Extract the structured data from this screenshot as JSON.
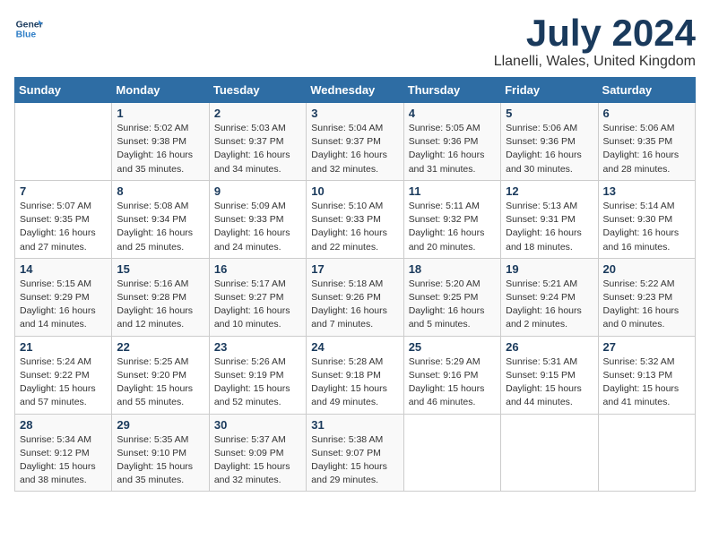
{
  "header": {
    "logo_line1": "General",
    "logo_line2": "Blue",
    "month": "July 2024",
    "location": "Llanelli, Wales, United Kingdom"
  },
  "days_of_week": [
    "Sunday",
    "Monday",
    "Tuesday",
    "Wednesday",
    "Thursday",
    "Friday",
    "Saturday"
  ],
  "weeks": [
    [
      {
        "day": "",
        "info": ""
      },
      {
        "day": "1",
        "info": "Sunrise: 5:02 AM\nSunset: 9:38 PM\nDaylight: 16 hours\nand 35 minutes."
      },
      {
        "day": "2",
        "info": "Sunrise: 5:03 AM\nSunset: 9:37 PM\nDaylight: 16 hours\nand 34 minutes."
      },
      {
        "day": "3",
        "info": "Sunrise: 5:04 AM\nSunset: 9:37 PM\nDaylight: 16 hours\nand 32 minutes."
      },
      {
        "day": "4",
        "info": "Sunrise: 5:05 AM\nSunset: 9:36 PM\nDaylight: 16 hours\nand 31 minutes."
      },
      {
        "day": "5",
        "info": "Sunrise: 5:06 AM\nSunset: 9:36 PM\nDaylight: 16 hours\nand 30 minutes."
      },
      {
        "day": "6",
        "info": "Sunrise: 5:06 AM\nSunset: 9:35 PM\nDaylight: 16 hours\nand 28 minutes."
      }
    ],
    [
      {
        "day": "7",
        "info": "Sunrise: 5:07 AM\nSunset: 9:35 PM\nDaylight: 16 hours\nand 27 minutes."
      },
      {
        "day": "8",
        "info": "Sunrise: 5:08 AM\nSunset: 9:34 PM\nDaylight: 16 hours\nand 25 minutes."
      },
      {
        "day": "9",
        "info": "Sunrise: 5:09 AM\nSunset: 9:33 PM\nDaylight: 16 hours\nand 24 minutes."
      },
      {
        "day": "10",
        "info": "Sunrise: 5:10 AM\nSunset: 9:33 PM\nDaylight: 16 hours\nand 22 minutes."
      },
      {
        "day": "11",
        "info": "Sunrise: 5:11 AM\nSunset: 9:32 PM\nDaylight: 16 hours\nand 20 minutes."
      },
      {
        "day": "12",
        "info": "Sunrise: 5:13 AM\nSunset: 9:31 PM\nDaylight: 16 hours\nand 18 minutes."
      },
      {
        "day": "13",
        "info": "Sunrise: 5:14 AM\nSunset: 9:30 PM\nDaylight: 16 hours\nand 16 minutes."
      }
    ],
    [
      {
        "day": "14",
        "info": "Sunrise: 5:15 AM\nSunset: 9:29 PM\nDaylight: 16 hours\nand 14 minutes."
      },
      {
        "day": "15",
        "info": "Sunrise: 5:16 AM\nSunset: 9:28 PM\nDaylight: 16 hours\nand 12 minutes."
      },
      {
        "day": "16",
        "info": "Sunrise: 5:17 AM\nSunset: 9:27 PM\nDaylight: 16 hours\nand 10 minutes."
      },
      {
        "day": "17",
        "info": "Sunrise: 5:18 AM\nSunset: 9:26 PM\nDaylight: 16 hours\nand 7 minutes."
      },
      {
        "day": "18",
        "info": "Sunrise: 5:20 AM\nSunset: 9:25 PM\nDaylight: 16 hours\nand 5 minutes."
      },
      {
        "day": "19",
        "info": "Sunrise: 5:21 AM\nSunset: 9:24 PM\nDaylight: 16 hours\nand 2 minutes."
      },
      {
        "day": "20",
        "info": "Sunrise: 5:22 AM\nSunset: 9:23 PM\nDaylight: 16 hours\nand 0 minutes."
      }
    ],
    [
      {
        "day": "21",
        "info": "Sunrise: 5:24 AM\nSunset: 9:22 PM\nDaylight: 15 hours\nand 57 minutes."
      },
      {
        "day": "22",
        "info": "Sunrise: 5:25 AM\nSunset: 9:20 PM\nDaylight: 15 hours\nand 55 minutes."
      },
      {
        "day": "23",
        "info": "Sunrise: 5:26 AM\nSunset: 9:19 PM\nDaylight: 15 hours\nand 52 minutes."
      },
      {
        "day": "24",
        "info": "Sunrise: 5:28 AM\nSunset: 9:18 PM\nDaylight: 15 hours\nand 49 minutes."
      },
      {
        "day": "25",
        "info": "Sunrise: 5:29 AM\nSunset: 9:16 PM\nDaylight: 15 hours\nand 46 minutes."
      },
      {
        "day": "26",
        "info": "Sunrise: 5:31 AM\nSunset: 9:15 PM\nDaylight: 15 hours\nand 44 minutes."
      },
      {
        "day": "27",
        "info": "Sunrise: 5:32 AM\nSunset: 9:13 PM\nDaylight: 15 hours\nand 41 minutes."
      }
    ],
    [
      {
        "day": "28",
        "info": "Sunrise: 5:34 AM\nSunset: 9:12 PM\nDaylight: 15 hours\nand 38 minutes."
      },
      {
        "day": "29",
        "info": "Sunrise: 5:35 AM\nSunset: 9:10 PM\nDaylight: 15 hours\nand 35 minutes."
      },
      {
        "day": "30",
        "info": "Sunrise: 5:37 AM\nSunset: 9:09 PM\nDaylight: 15 hours\nand 32 minutes."
      },
      {
        "day": "31",
        "info": "Sunrise: 5:38 AM\nSunset: 9:07 PM\nDaylight: 15 hours\nand 29 minutes."
      },
      {
        "day": "",
        "info": ""
      },
      {
        "day": "",
        "info": ""
      },
      {
        "day": "",
        "info": ""
      }
    ]
  ]
}
